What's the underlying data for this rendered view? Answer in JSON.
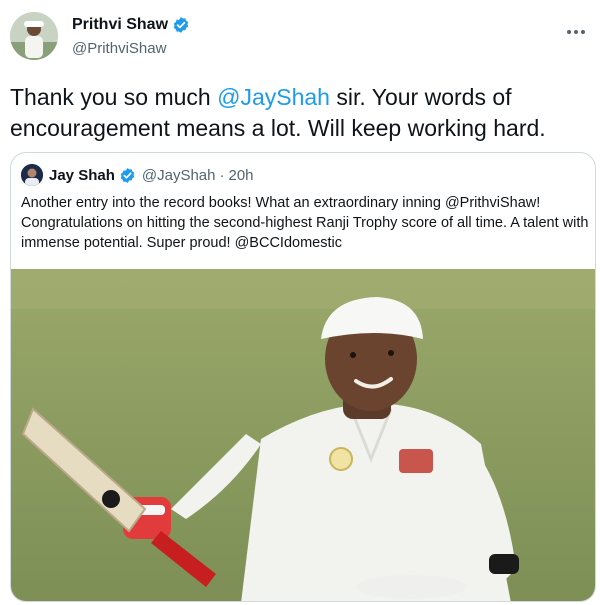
{
  "author": {
    "name": "Prithvi Shaw",
    "handle": "@PrithviShaw",
    "verified": true
  },
  "tweet": {
    "text_before": "Thank you so much ",
    "mention": "@JayShah",
    "text_after": " sir. Your words of encouragement means a lot. Will keep working hard."
  },
  "quoted": {
    "name": "Jay Shah",
    "handle": "@JayShah",
    "separator": "·",
    "time": "20h",
    "text": "Another entry into the record books! What an extraordinary inning @PrithviShaw! Congratulations on hitting the second-highest Ranji Trophy score of all time. A talent with immense potential. Super proud! @BCCIdomestic"
  },
  "icons": {
    "verified": "verified-badge-icon",
    "more": "more-options-icon"
  },
  "colors": {
    "accent": "#1d9bf0",
    "text": "#0f1419",
    "secondary": "#536471",
    "border": "#cfd9de"
  }
}
